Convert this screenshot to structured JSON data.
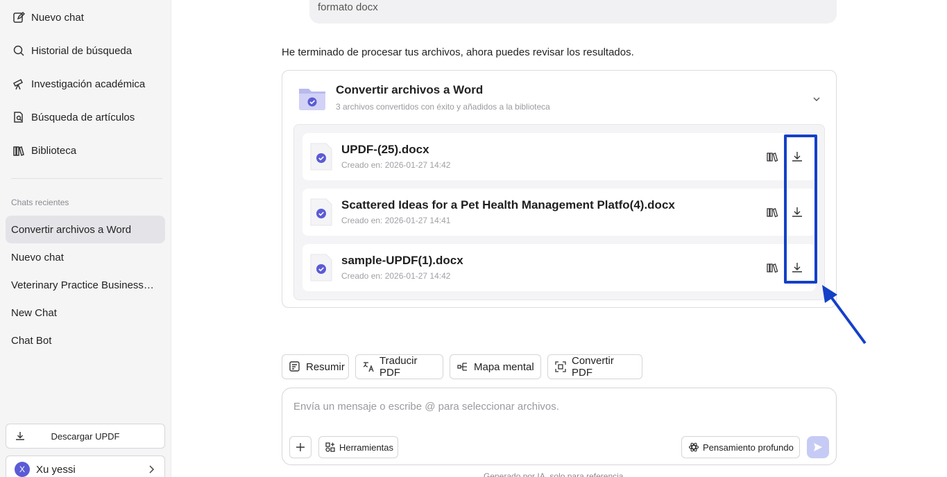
{
  "sidebar": {
    "nav": [
      {
        "label": "Nuevo chat",
        "icon": "edit-icon"
      },
      {
        "label": "Historial de búsqueda",
        "icon": "search-icon"
      },
      {
        "label": "Investigación académica",
        "icon": "telescope-icon"
      },
      {
        "label": "Búsqueda de artículos",
        "icon": "document-search-icon"
      },
      {
        "label": "Biblioteca",
        "icon": "library-icon"
      }
    ],
    "recent_label": "Chats recientes",
    "recent": [
      {
        "label": "Convertir archivos a Word",
        "active": true
      },
      {
        "label": "Nuevo chat",
        "active": false
      },
      {
        "label": "Veterinary Practice Business Plan",
        "active": false
      },
      {
        "label": "New Chat",
        "active": false
      },
      {
        "label": "Chat Bot",
        "active": false
      }
    ],
    "download_label": "Descargar UPDF",
    "user": {
      "initial": "X",
      "name": "Xu yessi"
    }
  },
  "conversation": {
    "user_message": "formato docx",
    "assistant_message": "He terminado de procesar tus archivos, ahora puedes revisar los resultados."
  },
  "card": {
    "title": "Convertir archivos a Word",
    "subtitle": "3 archivos convertidos con éxito y añadidos a la biblioteca",
    "files": [
      {
        "name": "UPDF-(25).docx",
        "date": "Creado en: 2026-01-27 14:42"
      },
      {
        "name": "Scattered Ideas for a Pet Health Management Platfo(4).docx",
        "date": "Creado en: 2026-01-27 14:41"
      },
      {
        "name": "sample-UPDF(1).docx",
        "date": "Creado en: 2026-01-27 14:42"
      }
    ]
  },
  "quick_actions": [
    {
      "label": "Resumir",
      "icon": "summarize-icon"
    },
    {
      "label": "Traducir PDF",
      "icon": "translate-icon"
    },
    {
      "label": "Mapa mental",
      "icon": "mindmap-icon"
    },
    {
      "label": "Convertir PDF",
      "icon": "convert-icon"
    }
  ],
  "composer": {
    "placeholder": "Envía un mensaje o escribe @ para seleccionar archivos.",
    "tools_label": "Herramientas",
    "think_label": "Pensamiento profundo"
  },
  "footnote": "Generado por IA, solo para referencia",
  "colors": {
    "accent": "#5b5bd6",
    "highlight": "#1440c8",
    "send": "#c6cbf5"
  }
}
